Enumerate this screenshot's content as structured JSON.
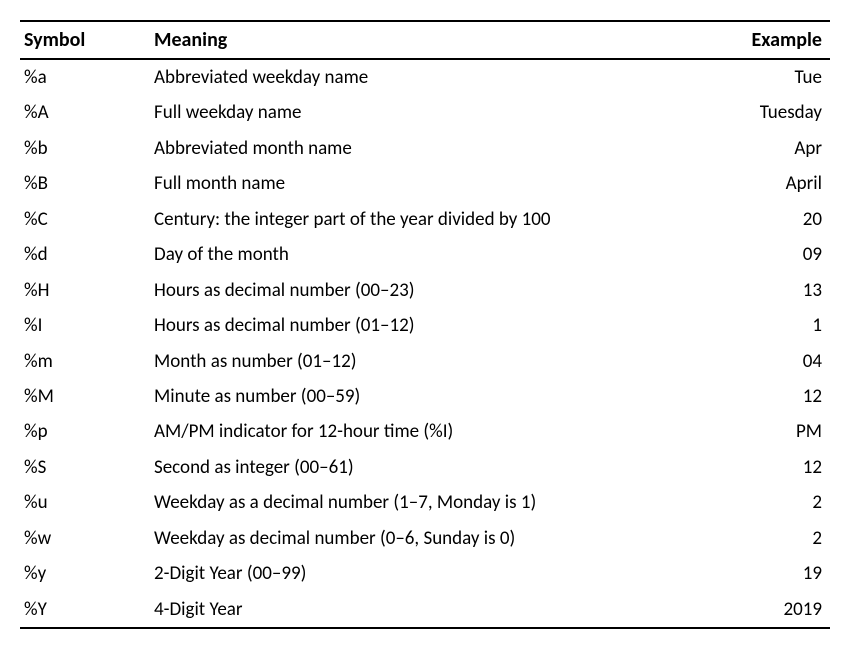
{
  "table": {
    "headers": {
      "symbol": "Symbol",
      "meaning": "Meaning",
      "example": "Example"
    },
    "rows": [
      {
        "symbol": "%a",
        "meaning": "Abbreviated weekday name",
        "example": "Tue"
      },
      {
        "symbol": "%A",
        "meaning": "Full weekday name",
        "example": "Tuesday"
      },
      {
        "symbol": "%b",
        "meaning": "Abbreviated month name",
        "example": "Apr"
      },
      {
        "symbol": "%B",
        "meaning": "Full month name",
        "example": "April"
      },
      {
        "symbol": "%C",
        "meaning": "Century: the integer part of the year divided by 100",
        "example": "20"
      },
      {
        "symbol": "%d",
        "meaning": "Day of the month",
        "example": "09"
      },
      {
        "symbol": "%H",
        "meaning": "Hours as decimal number (00–23)",
        "example": "13"
      },
      {
        "symbol": "%I",
        "meaning": "Hours as decimal number (01–12)",
        "example": "1"
      },
      {
        "symbol": "%m",
        "meaning": "Month as number (01–12)",
        "example": "04"
      },
      {
        "symbol": "%M",
        "meaning": "Minute as number (00–59)",
        "example": "12"
      },
      {
        "symbol": "%p",
        "meaning": "AM/PM indicator for 12-hour time (%I)",
        "example": "PM"
      },
      {
        "symbol": "%S",
        "meaning": "Second as integer (00–61)",
        "example": "12"
      },
      {
        "symbol": "%u",
        "meaning": "Weekday as a decimal number (1–7, Monday is 1)",
        "example": "2"
      },
      {
        "symbol": "%w",
        "meaning": "Weekday as decimal number (0–6, Sunday is 0)",
        "example": "2"
      },
      {
        "symbol": "%y",
        "meaning": "2-Digit Year (00–99)",
        "example": "19"
      },
      {
        "symbol": "%Y",
        "meaning": "4-Digit Year",
        "example": "2019"
      }
    ]
  }
}
